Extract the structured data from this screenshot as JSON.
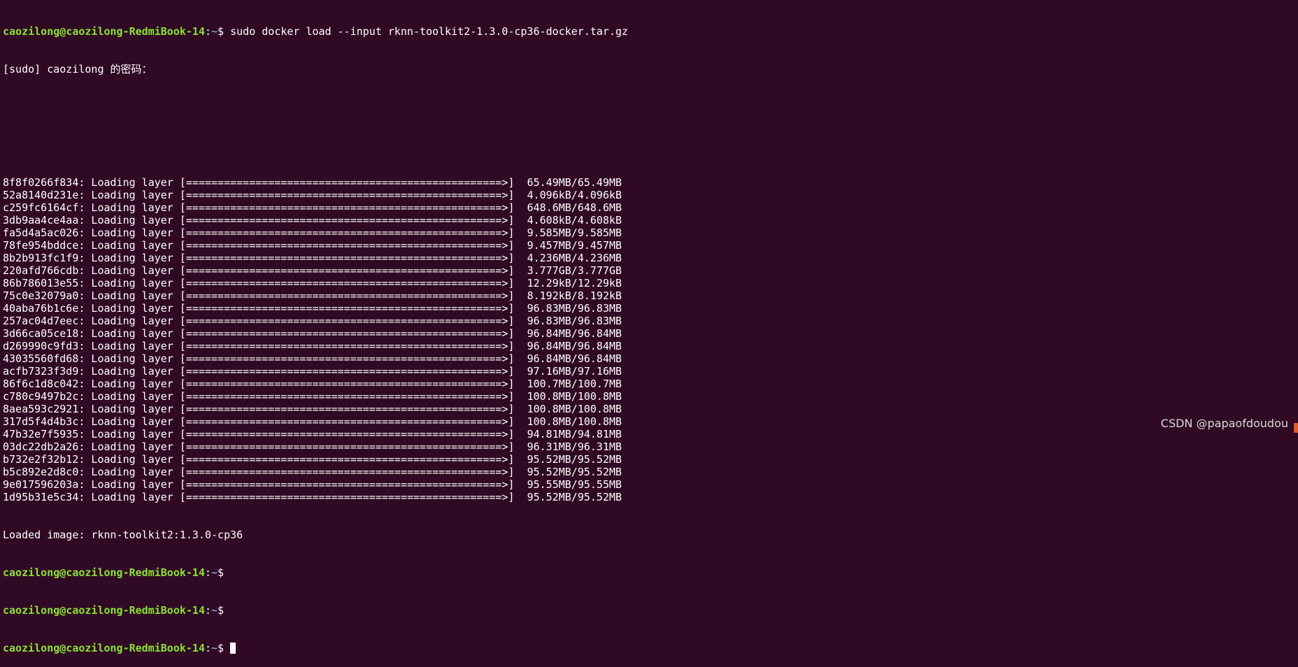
{
  "terminal": {
    "prompt_user": "caozilong@caozilong-RedmiBook-14",
    "prompt_path": "~",
    "prompt_symbol": "$",
    "command": " sudo docker load --input rknn-toolkit2-1.3.0-cp36-docker.tar.gz",
    "sudo_prompt": "[sudo] caozilong 的密码：",
    "layer_label": ": Loading layer ",
    "progress_bar": "[==================================================>]",
    "layers": [
      {
        "id": "8f8f0266f834",
        "size": "65.49MB/65.49MB"
      },
      {
        "id": "52a8140d231e",
        "size": "4.096kB/4.096kB"
      },
      {
        "id": "c259fc6164cf",
        "size": "648.6MB/648.6MB"
      },
      {
        "id": "3db9aa4ce4aa",
        "size": "4.608kB/4.608kB"
      },
      {
        "id": "fa5d4a5ac026",
        "size": "9.585MB/9.585MB"
      },
      {
        "id": "78fe954bddce",
        "size": "9.457MB/9.457MB"
      },
      {
        "id": "8b2b913fc1f9",
        "size": "4.236MB/4.236MB"
      },
      {
        "id": "220afd766cdb",
        "size": "3.777GB/3.777GB"
      },
      {
        "id": "86b786013e55",
        "size": "12.29kB/12.29kB"
      },
      {
        "id": "75c0e32079a0",
        "size": "8.192kB/8.192kB"
      },
      {
        "id": "40aba76b1c6e",
        "size": "96.83MB/96.83MB"
      },
      {
        "id": "257ac04d7eec",
        "size": "96.83MB/96.83MB"
      },
      {
        "id": "3d66ca05ce18",
        "size": "96.84MB/96.84MB"
      },
      {
        "id": "d269990c9fd3",
        "size": "96.84MB/96.84MB"
      },
      {
        "id": "43035560fd68",
        "size": "96.84MB/96.84MB"
      },
      {
        "id": "acfb7323f3d9",
        "size": "97.16MB/97.16MB"
      },
      {
        "id": "86f6c1d8c042",
        "size": "100.7MB/100.7MB"
      },
      {
        "id": "c780c9497b2c",
        "size": "100.8MB/100.8MB"
      },
      {
        "id": "8aea593c2921",
        "size": "100.8MB/100.8MB"
      },
      {
        "id": "317d5f4d4b3c",
        "size": "100.8MB/100.8MB"
      },
      {
        "id": "47b32e7f5935",
        "size": "94.81MB/94.81MB"
      },
      {
        "id": "03dc22db2a26",
        "size": "96.31MB/96.31MB"
      },
      {
        "id": "b732e2f32b12",
        "size": "95.52MB/95.52MB"
      },
      {
        "id": "b5c892e2d8c0",
        "size": "95.52MB/95.52MB"
      },
      {
        "id": "9e017596203a",
        "size": "95.55MB/95.55MB"
      },
      {
        "id": "1d95b31e5c34",
        "size": "95.52MB/95.52MB"
      }
    ],
    "loaded_message": "Loaded image: rknn-toolkit2:1.3.0-cp36"
  },
  "watermark": "CSDN @papaofdoudou",
  "colors": {
    "background": "#300a24",
    "prompt_user": "#8ae234",
    "prompt_path": "#729fcf",
    "text": "#ffffff"
  }
}
